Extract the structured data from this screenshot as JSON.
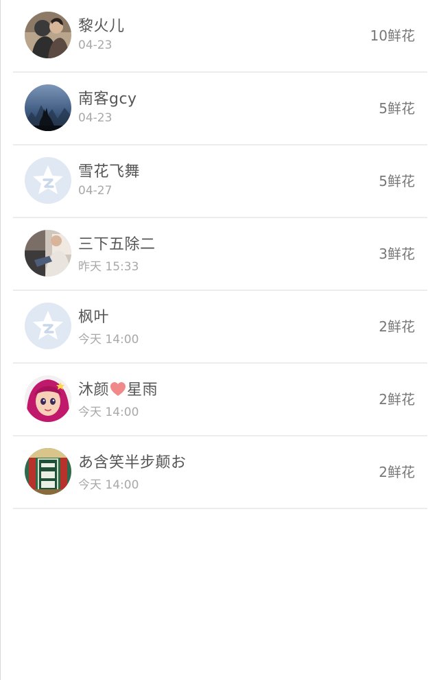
{
  "items": [
    {
      "name": "黎火儿",
      "time": "04-23",
      "flowers": "10鲜花",
      "avatar": "photo-couple"
    },
    {
      "name": "南客gcy",
      "time": "04-23",
      "flowers": "5鲜花",
      "avatar": "wolf-night"
    },
    {
      "name": "雪花飞舞",
      "time": "04-27",
      "flowers": "5鲜花",
      "avatar": "default-qzone-star"
    },
    {
      "name": "三下五除二",
      "time": "昨天 15:33",
      "flowers": "3鲜花",
      "avatar": "photo-person"
    },
    {
      "name": "枫叶",
      "time": "今天 14:00",
      "flowers": "2鲜花",
      "avatar": "default-qzone-star"
    },
    {
      "name_a": "沐颜",
      "name_b": "星雨",
      "name_icon": "heart-icon",
      "time": "今天 14:00",
      "flowers": "2鲜花",
      "avatar": "cartoon-girl"
    },
    {
      "name": "あ含笑半步颠お",
      "time": "今天 14:00",
      "flowers": "2鲜花",
      "avatar": "green-ornament"
    }
  ],
  "colors": {
    "name_text": "#555555",
    "time_text": "#a8a8a8",
    "flowers_text": "#777777",
    "divider": "#ececec",
    "default_avatar_bg": "#dfe8f3",
    "heart": "#f08a8a"
  }
}
